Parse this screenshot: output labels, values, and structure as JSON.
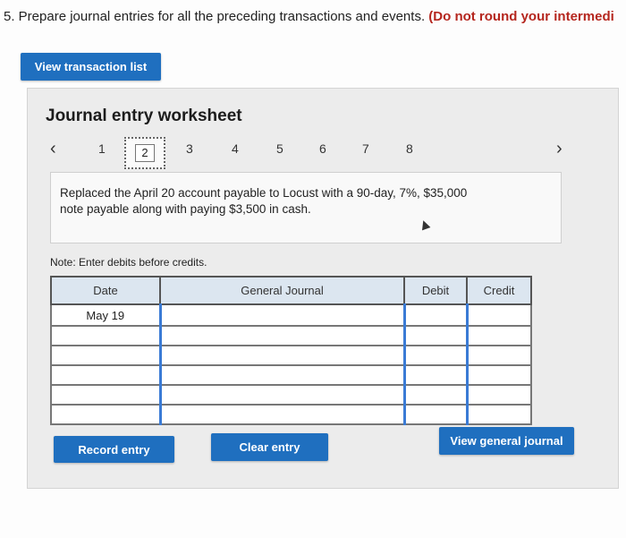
{
  "question": {
    "prefix": "5. Prepare journal entries for all the preceding transactions and events.",
    "emphasis": "(Do not round your intermedi"
  },
  "view_transaction_list": "View transaction list",
  "worksheet": {
    "title": "Journal entry worksheet",
    "nav": {
      "prev_icon": "chevron-left-icon",
      "next_icon": "chevron-right-icon",
      "items": [
        "1",
        "2",
        "3",
        "4",
        "5",
        "6",
        "7",
        "8"
      ],
      "current": "2"
    },
    "description_line1": "Replaced the April 20 account payable to Locust with a 90-day, 7%, $35,000",
    "description_line2": "note payable along with paying $3,500 in cash.",
    "note": "Note: Enter debits before credits.",
    "table": {
      "headers": {
        "date": "Date",
        "journal": "General Journal",
        "debit": "Debit",
        "credit": "Credit"
      },
      "rows": [
        {
          "date": "May 19",
          "journal": "",
          "debit": "",
          "credit": ""
        },
        {
          "date": "",
          "journal": "",
          "debit": "",
          "credit": ""
        },
        {
          "date": "",
          "journal": "",
          "debit": "",
          "credit": ""
        },
        {
          "date": "",
          "journal": "",
          "debit": "",
          "credit": ""
        },
        {
          "date": "",
          "journal": "",
          "debit": "",
          "credit": ""
        },
        {
          "date": "",
          "journal": "",
          "debit": "",
          "credit": ""
        }
      ]
    },
    "buttons": {
      "record": "Record entry",
      "clear": "Clear entry",
      "view_general_journal": "View general journal"
    }
  },
  "colors": {
    "accent": "#1f6fbf",
    "emphasis": "#b5261e",
    "header": "#dce6f0"
  }
}
